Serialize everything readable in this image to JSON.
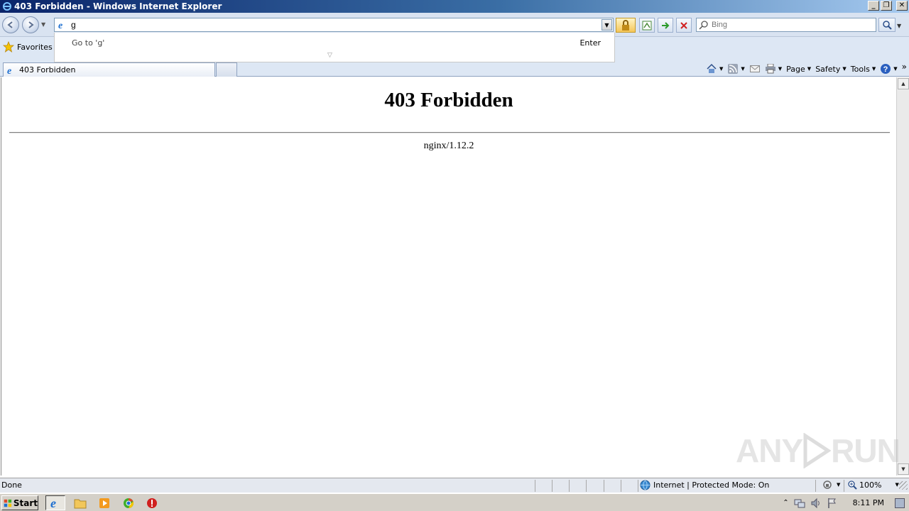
{
  "window": {
    "title": "403 Forbidden - Windows Internet Explorer",
    "controls": {
      "minimize": "_",
      "restore": "❐",
      "close": "✕"
    }
  },
  "navbar": {
    "address_value": "g",
    "search_placeholder": "Bing"
  },
  "autocomplete": {
    "goto_text": "Go to 'g'",
    "enter_text": "Enter"
  },
  "favorites_bar": {
    "favorites_label": "Favorites"
  },
  "tabs": [
    {
      "label": "403 Forbidden"
    }
  ],
  "command_bar": {
    "page_label": "Page",
    "safety_label": "Safety",
    "tools_label": "Tools",
    "more": "»"
  },
  "page": {
    "heading": "403 Forbidden",
    "server": "nginx/1.12.2"
  },
  "watermark": {
    "left": "ANY",
    "right": "RUN"
  },
  "status_bar": {
    "status": "Done",
    "zone": "Internet | Protected Mode: On",
    "zoom": "100%"
  },
  "taskbar": {
    "start_label": "Start",
    "clock": "8:11 PM"
  },
  "colors": {
    "titlebar_start": "#0a246a",
    "titlebar_end": "#a6caf0",
    "chrome_bg": "#dde7f4",
    "taskbar_bg": "#d4d0c8"
  }
}
